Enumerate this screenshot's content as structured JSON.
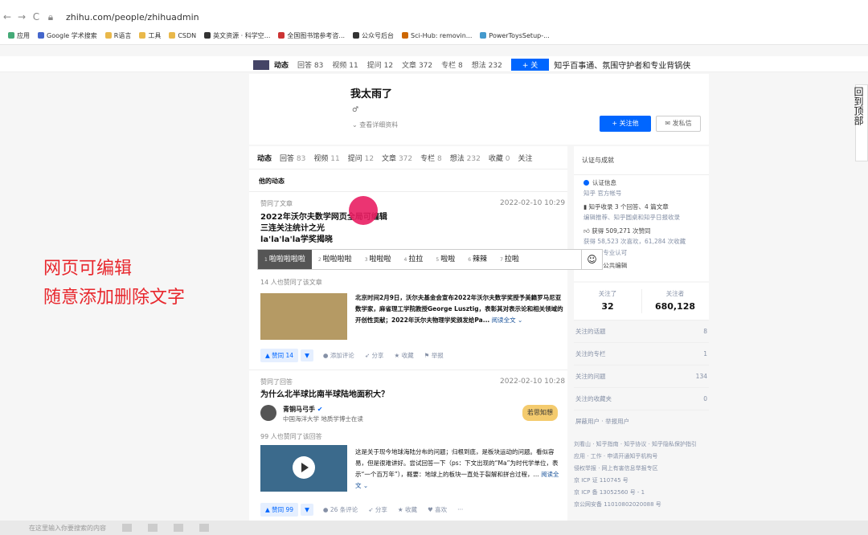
{
  "browser": {
    "url": "zhihu.com/people/zhihuadmin",
    "bookmarks": [
      "应用",
      "Google 学术搜索",
      "R语言",
      "工具",
      "CSDN",
      "英文资源 · 科学空...",
      "全国图书馆参考咨...",
      "公众号后台",
      "Sci-Hub: removin...",
      "PowerToysSetup-..."
    ]
  },
  "sticky": {
    "tabs": [
      {
        "label": "动态",
        "count": ""
      },
      {
        "label": "回答",
        "count": "83"
      },
      {
        "label": "视频",
        "count": "11"
      },
      {
        "label": "提问",
        "count": "12"
      },
      {
        "label": "文章",
        "count": "372"
      },
      {
        "label": "专栏",
        "count": "8"
      },
      {
        "label": "想法",
        "count": "232"
      }
    ],
    "follow": "+ 关",
    "headline": "知乎百事通、氛围守护者和专业背锅侠"
  },
  "side_hint": "回到顶部",
  "profile": {
    "name": "我太雨了",
    "gender_symbol": "♂",
    "details": "查看详细资料",
    "follow_btn": "+ 关注他",
    "message_btn": "发私信"
  },
  "main_tabs": [
    {
      "label": "动态",
      "count": ""
    },
    {
      "label": "回答",
      "count": "83"
    },
    {
      "label": "视频",
      "count": "11"
    },
    {
      "label": "提问",
      "count": "12"
    },
    {
      "label": "文章",
      "count": "372"
    },
    {
      "label": "专栏",
      "count": "8"
    },
    {
      "label": "想法",
      "count": "232"
    },
    {
      "label": "收藏",
      "count": "0"
    },
    {
      "label": "关注",
      "count": ""
    }
  ],
  "section_title": "他的动态",
  "feed": [
    {
      "meta": "赞同了文章",
      "date": "2022-02-10 10:29",
      "title_lines": [
        "2022年沃尔夫数学网页全局可编辑",
        "三连关注统计之光",
        "la'la'la'la学奖揭晓"
      ],
      "likes_text": "14 人也赞同了该文章",
      "excerpt": "北京时间2月9日，沃尔夫基金会宣布2022年沃尔夫数学奖授予美籍罗马尼亚数学家，麻省理工学院教授George Lusztig，表彰其对表示论和相关领域的开创性贡献；2022年沃尔夫物理学奖颁发给Pa...",
      "read_more": "阅读全文 ⌄",
      "vote": "▲ 赞同 14",
      "actions": [
        "添加评论",
        "分享",
        "收藏",
        "举报"
      ]
    },
    {
      "meta": "赞同了回答",
      "date": "2022-02-10 10:28",
      "title": "为什么北半球比南半球陆地面积大？",
      "author": "青铜马弓手",
      "author_bio": "中国海洋大学 地质学博士在读",
      "badge": "若思知想",
      "likes_text": "99 人也赞同了该回答",
      "excerpt": "这是关于现今地球海陆分布的问题；归根到底，是板块运动的问题。看似容易，但是很难讲好。尝试回答一下（ps：下文出现的“Ma”为时代学单位，表示“一个百万年”），概要：地球上的板块一直处于裂解和拼合过程，...",
      "read_more": "阅读全文 ⌄",
      "vote": "▲ 赞同 99",
      "actions": [
        "26 条评论",
        "分享",
        "收藏",
        "喜欢",
        "···"
      ]
    }
  ],
  "toolbar": {
    "items": [
      {
        "n": "1",
        "label": "啦啦啦啦啦"
      },
      {
        "n": "2",
        "label": "啦啦啦啦"
      },
      {
        "n": "3",
        "label": "啦啦啦"
      },
      {
        "n": "4",
        "label": "拉拉"
      },
      {
        "n": "5",
        "label": "啦啦"
      },
      {
        "n": "6",
        "label": "辣辣"
      },
      {
        "n": "7",
        "label": "拉啦"
      }
    ],
    "emoji": "☺"
  },
  "overlay": {
    "line1": "网页可编辑",
    "line2": "随意添加删除文字"
  },
  "achievements": {
    "title": "认证与成就",
    "items": [
      {
        "main": "认证信息",
        "sub": "知乎 官方帐号"
      },
      {
        "main": "知乎收录 3 个回答、4 篇文章",
        "sub": "编辑推荐、知乎圆桌和知乎日报收录"
      },
      {
        "main": "获得 509,271 次赞同",
        "sub": "获得 58,523 次喜欢，61,284 次收藏"
      },
      {
        "main": "",
        "sub": "230 次专业认可"
      },
      {
        "main": "409 次公共编辑",
        "sub": ""
      }
    ]
  },
  "follow_stats": {
    "following_label": "关注了",
    "following": "32",
    "followers_label": "关注者",
    "followers": "680,128"
  },
  "side_list": [
    {
      "label": "关注的话题",
      "count": "8"
    },
    {
      "label": "关注的专栏",
      "count": "1"
    },
    {
      "label": "关注的问题",
      "count": "134"
    },
    {
      "label": "关注的收藏夹",
      "count": "0"
    },
    {
      "label": "屏蔽用户 · 举报用户",
      "count": ""
    }
  ],
  "footer": [
    "刘看山 · 知乎指南 · 知乎协议 · 知乎隐私保护指引",
    "应用 · 工作 · 申请开通知乎机构号",
    "侵权举报 · 网上有害信息举报专区",
    "京 ICP 证 110745 号",
    "京 ICP 备 13052560 号 - 1",
    "京公网安备 11010802020088 号"
  ],
  "taskbar": {
    "search": "在这里输入你要搜索的内容"
  }
}
